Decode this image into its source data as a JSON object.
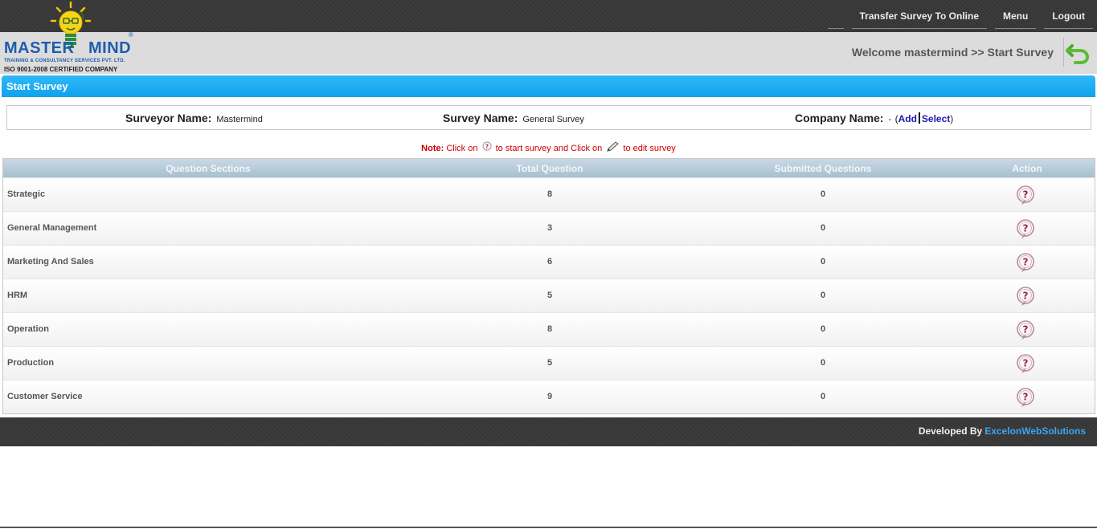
{
  "nav": {
    "transfer": "Transfer Survey To Online",
    "menu": "Menu",
    "logout": "Logout"
  },
  "logo": {
    "brand_left": "MASTER",
    "brand_right": "MIND",
    "registered": "®",
    "tagline": "TRAINING & CONSULTANCY SERVICES PVT. LTD.",
    "certification": "ISO 9001-2008 CERTIFIED COMPANY"
  },
  "header": {
    "welcome": "Welcome mastermind >> Start Survey",
    "back_icon": "back-arrow-icon"
  },
  "title": "Start Survey",
  "info": {
    "surveyor_label": "Surveyor Name:",
    "surveyor_value": "Mastermind",
    "survey_label": "Survey Name:",
    "survey_value": "General Survey",
    "company_label": "Company Name:",
    "company_value": "-",
    "open_paren": "(",
    "add": "Add",
    "select": "Select",
    "close_paren": ")"
  },
  "note": {
    "label": "Note:",
    "part1": "Click on",
    "part2": "to start survey and Click on",
    "part3": "to edit survey"
  },
  "table": {
    "headers": [
      "Question Sections",
      "Total Question",
      "Submitted Questions",
      "Action"
    ],
    "rows": [
      {
        "section": "Strategic",
        "total": "8",
        "submitted": "0"
      },
      {
        "section": "General Management",
        "total": "3",
        "submitted": "0"
      },
      {
        "section": "Marketing And Sales",
        "total": "6",
        "submitted": "0"
      },
      {
        "section": "HRM",
        "total": "5",
        "submitted": "0"
      },
      {
        "section": "Operation",
        "total": "8",
        "submitted": "0"
      },
      {
        "section": "Production",
        "total": "5",
        "submitted": "0"
      },
      {
        "section": "Customer Service",
        "total": "9",
        "submitted": "0"
      }
    ],
    "action_icon": "question-bubble-icon"
  },
  "footer": {
    "developed_by": "Developed By",
    "company": "ExcelonWebSolutions"
  },
  "colors": {
    "accent_blue": "#0da3ee",
    "dark_bar": "#3a3a3a",
    "note_red": "#cc0000",
    "link_blue": "#1a1ab0",
    "footer_link": "#3aa5f2"
  }
}
